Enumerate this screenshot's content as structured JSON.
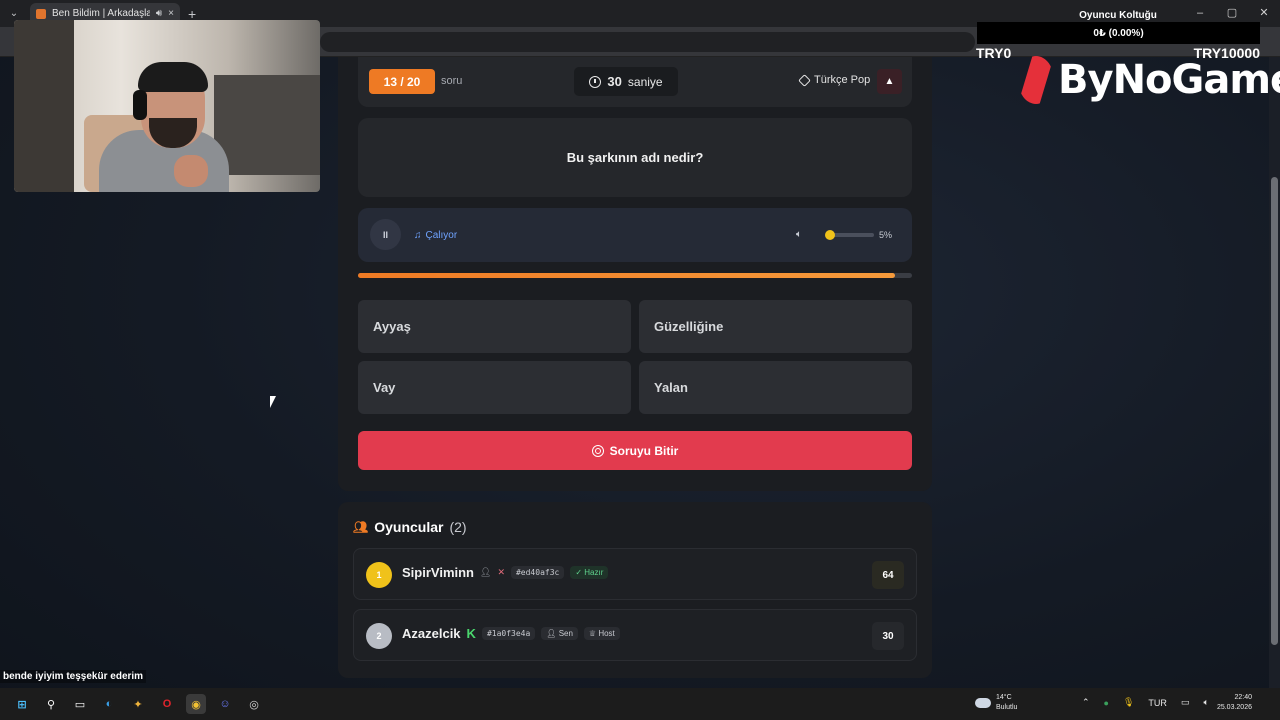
{
  "browser": {
    "tab_title": "Ben Bildim | Arkadaşlarınla",
    "tab_audio_icon": "speaker-icon",
    "close_icon": "×",
    "new_tab": "+",
    "win_minimize": "–",
    "win_maximize": "▢",
    "win_close": "✕"
  },
  "overlay": {
    "title": "Oyuncu Koltuğu",
    "value": "0₺ (0.00%)",
    "left_label": "TRY0",
    "right_label": "TRY10000",
    "brand": "ByNoGame"
  },
  "game": {
    "question_counter": "13 / 20",
    "question_word": "soru",
    "timer_value": "30",
    "timer_unit": "saniye",
    "category": "Türkçe Pop",
    "report_icon": "▲",
    "question": "Bu şarkının adı nedir?",
    "player": {
      "pause_glyph": "II",
      "status": "Çalıyor",
      "volume_percent": "5%",
      "volume_level": 0.05
    },
    "progress": 0.97,
    "answers": [
      "Ayyaş",
      "Güzelliğine",
      "Vay",
      "Yalan"
    ],
    "finish_button": "Soruyu Bitir"
  },
  "players": {
    "title": "Oyuncular",
    "count": "(2)",
    "list": [
      {
        "rank": "1",
        "name": "SipirViminn",
        "id": "#ed40af3c",
        "status": "Hazır",
        "score": "64"
      },
      {
        "rank": "2",
        "name": "Azazelcik",
        "badge": "K",
        "id": "#1a0f3e4a",
        "you": "Sen",
        "role": "Host",
        "score": "30"
      }
    ]
  },
  "subtitle": "bende iyiyim teşşekür ederim",
  "taskbar": {
    "weather_temp": "14°C",
    "weather_desc": "Bulutlu",
    "lang": "TUR",
    "time": "22:40",
    "date": "25.03.2026"
  },
  "colors": {
    "accent_orange": "#ee7a24",
    "finish_red": "#e23b4e",
    "ready_green": "#5fd38d",
    "rank1_gold": "#f0c21a",
    "rank2_silver": "#b8bcc4"
  }
}
